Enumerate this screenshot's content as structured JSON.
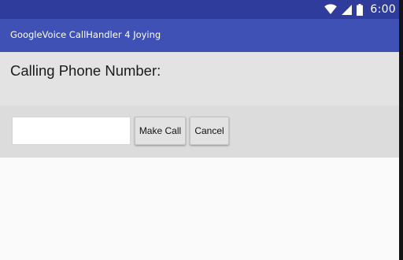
{
  "status_bar": {
    "time": "6:00",
    "icons": [
      "wifi-icon",
      "signal-icon",
      "battery-icon"
    ],
    "color": "#2f3c9b"
  },
  "app_bar": {
    "title": "GoogleVoice CallHandler 4 Joying",
    "color": "#3f51b5"
  },
  "prompt": {
    "label": "Calling Phone Number:"
  },
  "form": {
    "phone_value": "",
    "phone_placeholder": "",
    "make_call_label": "Make Call",
    "cancel_label": "Cancel"
  }
}
